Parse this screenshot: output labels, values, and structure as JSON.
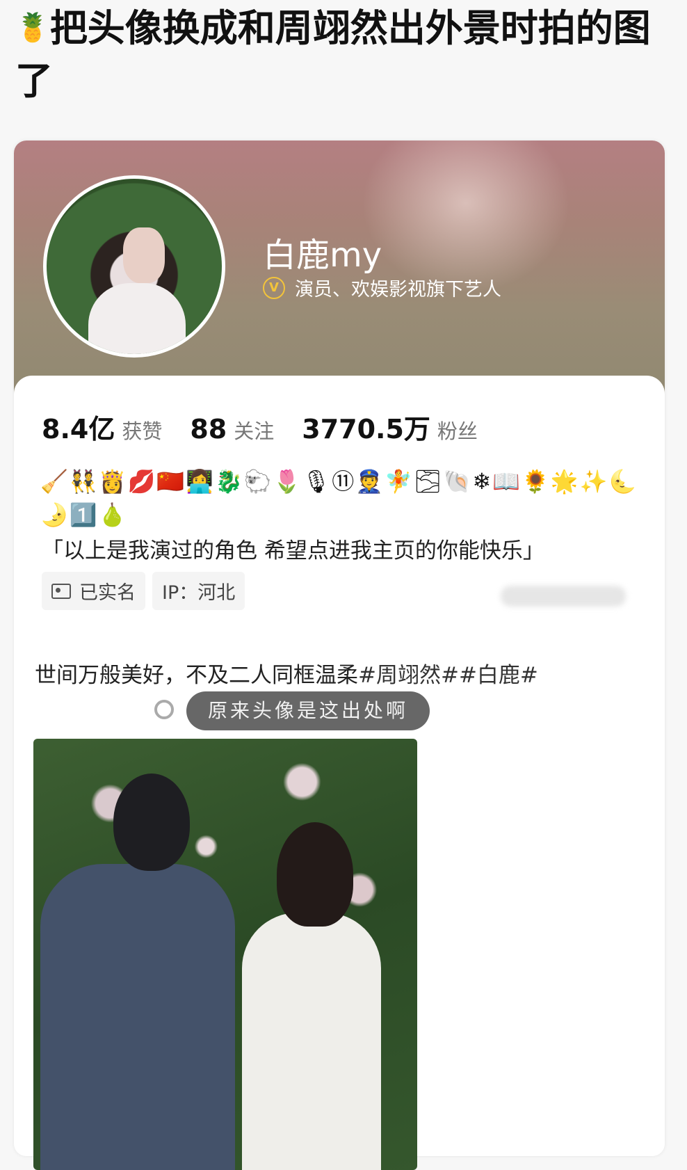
{
  "headline": {
    "emoji": "🍍",
    "text": "把头像换成和周翊然出外景时拍的图了"
  },
  "profile": {
    "name": "白鹿my",
    "verify_badge": "V",
    "verify_text": "演员、欢娱影视旗下艺人",
    "stats": [
      {
        "value": "8.4亿",
        "label": "获赞"
      },
      {
        "value": "88",
        "label": "关注"
      },
      {
        "value": "3770.5万",
        "label": "粉丝"
      }
    ],
    "emojis": "🧹👯👸💋🇨🇳👩‍💻🐉🐑🌷🎙⑪👮🧚🌫🐚❄📖🌻🌟✨🌜🌛1️⃣🍐",
    "bio": "「以上是我演过的角色 希望点进我主页的你能快乐」",
    "tags": {
      "real_name": "已实名",
      "ip": "IP：河北"
    }
  },
  "post": {
    "text": "世间万般美好，不及二人同框温柔",
    "hashtags": "#周翊然##白鹿#",
    "caption": "原来头像是这出处啊"
  }
}
